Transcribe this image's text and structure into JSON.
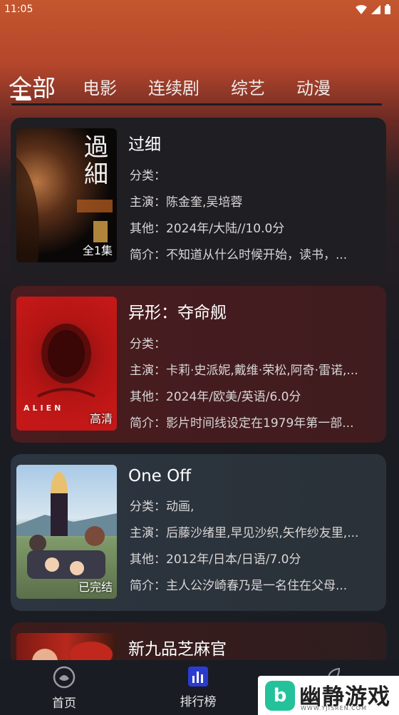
{
  "status": {
    "time": "11:05"
  },
  "tabs": [
    {
      "label": "全部",
      "active": true
    },
    {
      "label": "电影"
    },
    {
      "label": "连续剧"
    },
    {
      "label": "综艺"
    },
    {
      "label": "动漫"
    }
  ],
  "cards": [
    {
      "title": "过细",
      "category": "分类：",
      "cast": "主演：陈金奎,吴培蓉",
      "other": "其他：2024年/大陆//10.0分",
      "summary": "简介：不知道从什么时候开始，读书，...",
      "badge": "全1集",
      "poster_text": "過細"
    },
    {
      "title": "异形：夺命舰",
      "category": "分类：",
      "cast": "主演：卡莉·史派妮,戴维·荣松,阿奇·雷诺,...",
      "other": "其他：2024年/欧美/英语/6.0分",
      "summary": "简介：影片时间线设定在1979年第一部...",
      "badge": "高清",
      "poster_text": "ALIEN"
    },
    {
      "title": "One Off",
      "category": "分类：动画,",
      "cast": "主演：后藤沙绪里,早见沙织,矢作纱友里,...",
      "other": "其他：2012年/日本/日语/7.0分",
      "summary": "简介：主人公汐崎春乃是一名住在父母...",
      "badge": "已完结"
    },
    {
      "title": "新九品芝麻官"
    }
  ],
  "nav": [
    {
      "label": "首页"
    },
    {
      "label": "排行榜"
    }
  ],
  "watermark": {
    "name": "幽静游戏",
    "url": "WWW.YJISREN.COM",
    "logo_char": "b"
  },
  "colors": {
    "accent": "#c4572e",
    "nav_bg": "#1a1c24",
    "brand_green": "#24c29a"
  }
}
